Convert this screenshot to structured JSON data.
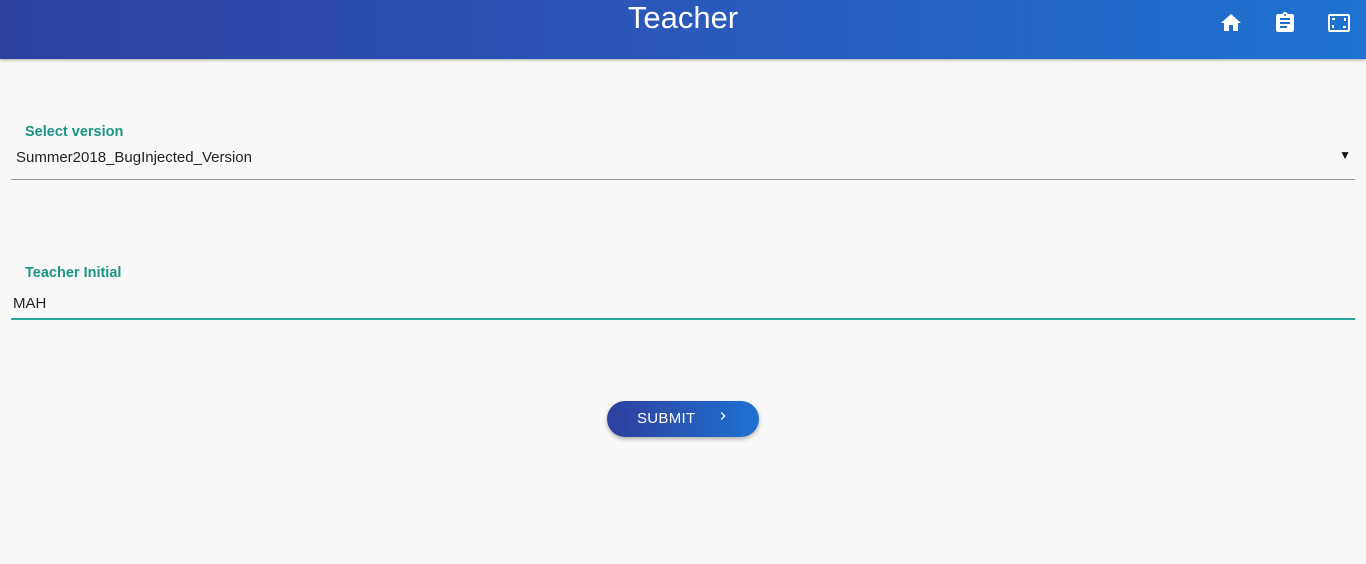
{
  "header": {
    "title": "Teacher",
    "icons": [
      "home-icon",
      "clipboard-icon",
      "fullscreen-icon"
    ]
  },
  "form": {
    "version": {
      "label": "Select version",
      "selected": "Summer2018_BugInjected_Version"
    },
    "teacher_initial": {
      "label": "Teacher Initial",
      "value": "MAH"
    },
    "submit_label": "SUBMIT"
  },
  "colors": {
    "header_gradient_start": "#2e3f9e",
    "header_gradient_end": "#1e72d0",
    "label_accent": "#1b9484",
    "input_underline_active": "#26a69a",
    "background": "#f8f8f8"
  }
}
